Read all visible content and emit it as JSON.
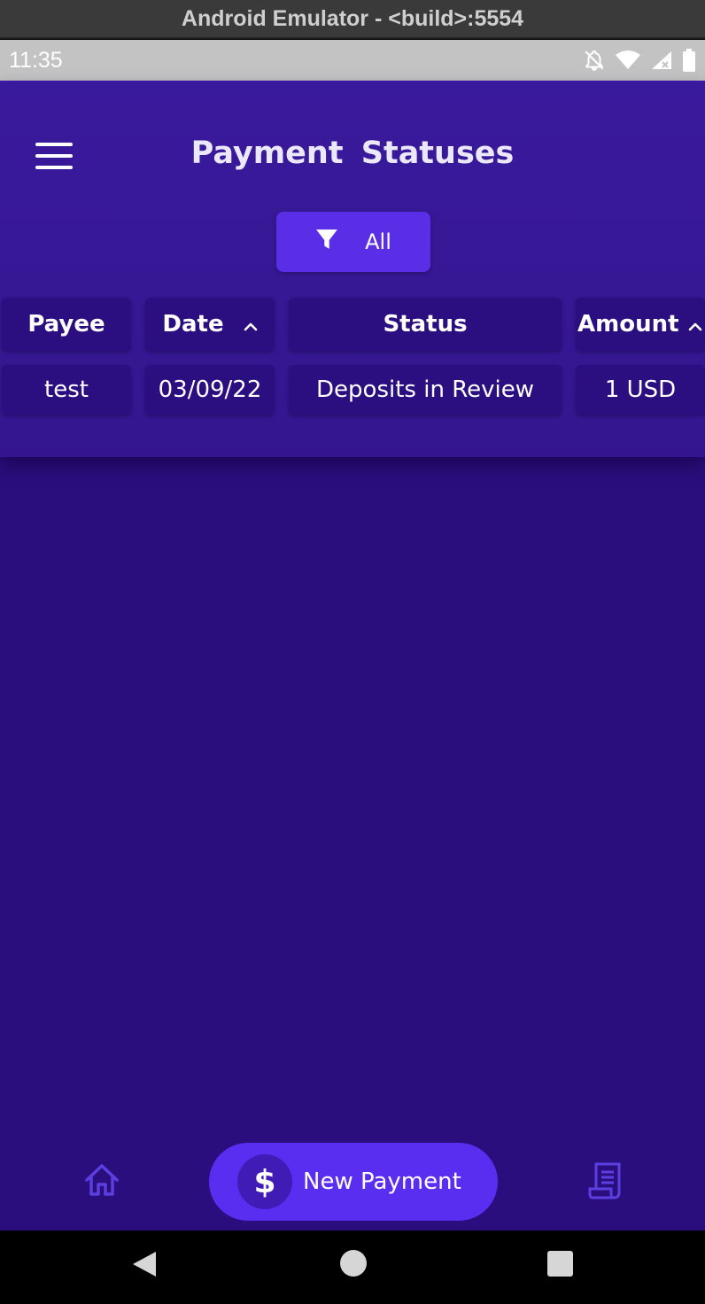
{
  "window": {
    "title": "Android Emulator - <build>:5554"
  },
  "status_bar": {
    "time": "11:35"
  },
  "header": {
    "title": "Payment  Statuses"
  },
  "filter": {
    "label": "All"
  },
  "table": {
    "columns": [
      {
        "label": "Payee"
      },
      {
        "label": "Date",
        "sort": "ascending"
      },
      {
        "label": "Status"
      },
      {
        "label": "Amount",
        "sort": "ascending"
      }
    ],
    "rows": [
      {
        "payee": "test",
        "date": "03/09/22",
        "status": "Deposits in Review",
        "amount": "1 USD"
      }
    ]
  },
  "bottom_nav": {
    "home_icon": "home-icon",
    "new_payment": {
      "icon": "$",
      "label": "New Payment"
    },
    "receipt_icon": "receipt-icon"
  },
  "colors": {
    "background": "#2b0e7e",
    "header": "#3a1a9c",
    "accent": "#5a2ee6",
    "cell": "#2b0e80"
  }
}
